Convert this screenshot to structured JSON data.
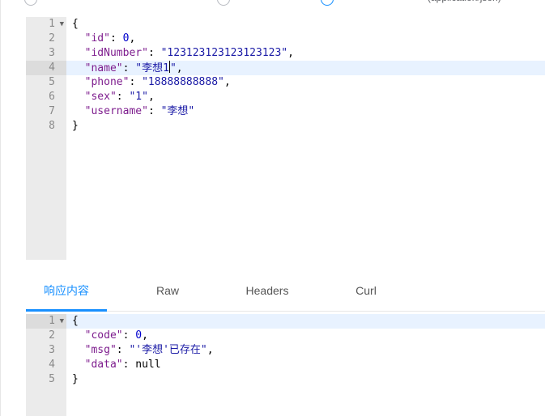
{
  "request_editor": {
    "lines": [
      [
        {
          "t": "pun",
          "v": "{"
        }
      ],
      [
        {
          "t": "pun",
          "v": "  "
        },
        {
          "t": "key",
          "v": "\"id\""
        },
        {
          "t": "pun",
          "v": ": "
        },
        {
          "t": "num",
          "v": "0"
        },
        {
          "t": "pun",
          "v": ","
        }
      ],
      [
        {
          "t": "pun",
          "v": "  "
        },
        {
          "t": "key",
          "v": "\"idNumber\""
        },
        {
          "t": "pun",
          "v": ": "
        },
        {
          "t": "str",
          "v": "\"123123123123123123\""
        },
        {
          "t": "pun",
          "v": ","
        }
      ],
      [
        {
          "t": "pun",
          "v": "  "
        },
        {
          "t": "key",
          "v": "\"name\""
        },
        {
          "t": "pun",
          "v": ": "
        },
        {
          "t": "str",
          "v": "\"李想1"
        },
        {
          "t": "cursor",
          "v": ""
        },
        {
          "t": "str",
          "v": "\""
        },
        {
          "t": "pun",
          "v": ","
        }
      ],
      [
        {
          "t": "pun",
          "v": "  "
        },
        {
          "t": "key",
          "v": "\"phone\""
        },
        {
          "t": "pun",
          "v": ": "
        },
        {
          "t": "str",
          "v": "\"18888888888\""
        },
        {
          "t": "pun",
          "v": ","
        }
      ],
      [
        {
          "t": "pun",
          "v": "  "
        },
        {
          "t": "key",
          "v": "\"sex\""
        },
        {
          "t": "pun",
          "v": ": "
        },
        {
          "t": "str",
          "v": "\"1\""
        },
        {
          "t": "pun",
          "v": ","
        }
      ],
      [
        {
          "t": "pun",
          "v": "  "
        },
        {
          "t": "key",
          "v": "\"username\""
        },
        {
          "t": "pun",
          "v": ": "
        },
        {
          "t": "str",
          "v": "\"李想\""
        }
      ],
      [
        {
          "t": "pun",
          "v": "}"
        }
      ]
    ],
    "line_numbers": [
      "1",
      "2",
      "3",
      "4",
      "5",
      "6",
      "7",
      "8"
    ],
    "active_line": 4,
    "fold_lines": [
      1
    ]
  },
  "tabs": {
    "items": [
      "响应内容",
      "Raw",
      "Headers",
      "Curl"
    ],
    "active": 0
  },
  "response_editor": {
    "lines": [
      [
        {
          "t": "pun",
          "v": "{"
        }
      ],
      [
        {
          "t": "pun",
          "v": "  "
        },
        {
          "t": "key",
          "v": "\"code\""
        },
        {
          "t": "pun",
          "v": ": "
        },
        {
          "t": "num",
          "v": "0"
        },
        {
          "t": "pun",
          "v": ","
        }
      ],
      [
        {
          "t": "pun",
          "v": "  "
        },
        {
          "t": "key",
          "v": "\"msg\""
        },
        {
          "t": "pun",
          "v": ": "
        },
        {
          "t": "str",
          "v": "\"'李想'已存在\""
        },
        {
          "t": "pun",
          "v": ","
        }
      ],
      [
        {
          "t": "pun",
          "v": "  "
        },
        {
          "t": "key",
          "v": "\"data\""
        },
        {
          "t": "pun",
          "v": ": "
        },
        {
          "t": "pun",
          "v": "null"
        }
      ],
      [
        {
          "t": "pun",
          "v": "}"
        }
      ]
    ],
    "line_numbers": [
      "1",
      "2",
      "3",
      "4",
      "5"
    ],
    "active_line": 1,
    "fold_lines": [
      1
    ]
  },
  "colors": {
    "accent": "#1890ff",
    "json_key": "#7e1d8e",
    "json_string": "#1a1aa6",
    "json_number": "#0000cd"
  },
  "icons": {
    "fold": "chevron-down-icon"
  }
}
